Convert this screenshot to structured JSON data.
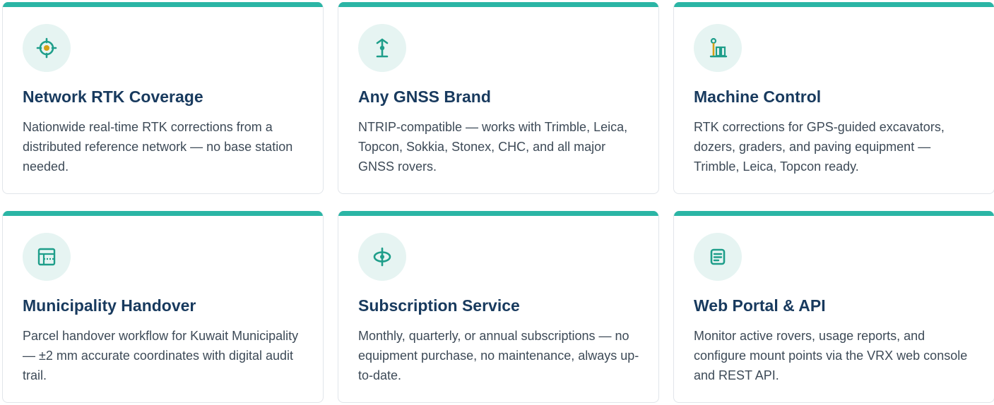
{
  "colors": {
    "accent": "#2bb5a5",
    "icon_bg": "#e6f4f2",
    "icon_stroke": "#1e9e8a",
    "icon_highlight": "#d4a017",
    "title": "#183a5e",
    "text": "#3d4a57"
  },
  "cards": [
    {
      "icon": "crosshair-target-icon",
      "title": "Network RTK Coverage",
      "description": "Nationwide real-time RTK corrections from a distributed reference network — no base station needed."
    },
    {
      "icon": "antenna-icon",
      "title": "Any GNSS Brand",
      "description": "NTRIP-compatible — works with Trimble, Leica, Topcon, Sokkia, Stonex, CHC, and all major GNSS rovers."
    },
    {
      "icon": "machine-control-icon",
      "title": "Machine Control",
      "description": "RTK corrections for GPS-guided excavators, dozers, graders, and paving equipment — Trimble, Leica, Topcon ready."
    },
    {
      "icon": "parcel-grid-icon",
      "title": "Municipality Handover",
      "description": "Parcel handover workflow for Kuwait Municipality — ±2 mm accurate coordinates with digital audit trail."
    },
    {
      "icon": "subscription-orbit-icon",
      "title": "Subscription Service",
      "description": "Monthly, quarterly, or annual subscriptions — no equipment purchase, no maintenance, always up-to-date."
    },
    {
      "icon": "document-icon",
      "title": "Web Portal & API",
      "description": "Monitor active rovers, usage reports, and configure mount points via the VRX web console and REST API."
    }
  ]
}
